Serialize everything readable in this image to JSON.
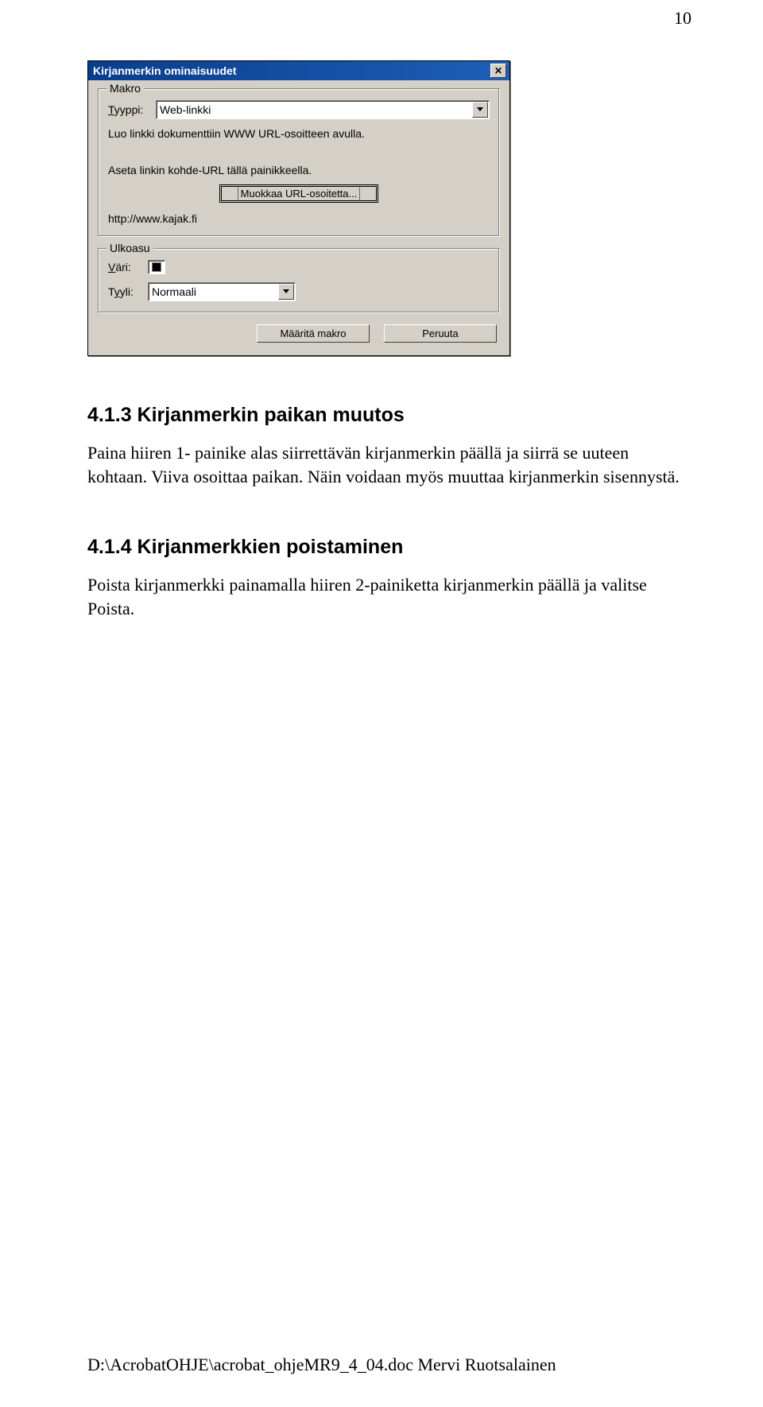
{
  "page_number": "10",
  "dialog": {
    "title": "Kirjanmerkin ominaisuudet",
    "makro_group": "Makro",
    "tyyppi_label": "Tyyppi:",
    "tyyppi_value": "Web-linkki",
    "desc1": "Luo linkki dokumenttiin WWW URL-osoitteen avulla.",
    "desc2": "Aseta linkin kohde-URL tällä painikkeella.",
    "edit_url_btn": "Muokkaa URL-osoitetta...",
    "url_value": "http://www.kajak.fi",
    "ulkoasu_group": "Ulkoasu",
    "vari_label": "Väri:",
    "tyyli_label": "Tyyli:",
    "tyyli_value": "Normaali",
    "ok_btn": "Määritä makro",
    "cancel_btn": "Peruuta"
  },
  "section1": {
    "heading": "4.1.3 Kirjanmerkin paikan muutos",
    "text": "Paina hiiren 1- painike alas siirrettävän kirjanmerkin päällä ja siirrä se uuteen kohtaan. Viiva osoittaa paikan. Näin voidaan myös muuttaa kirjanmerkin sisennystä."
  },
  "section2": {
    "heading": "4.1.4 Kirjanmerkkien poistaminen",
    "text": "Poista kirjanmerkki painamalla hiiren 2-painiketta kirjanmerkin päällä ja valitse Poista."
  },
  "footer": "D:\\AcrobatOHJE\\acrobat_ohjeMR9_4_04.doc Mervi Ruotsalainen"
}
